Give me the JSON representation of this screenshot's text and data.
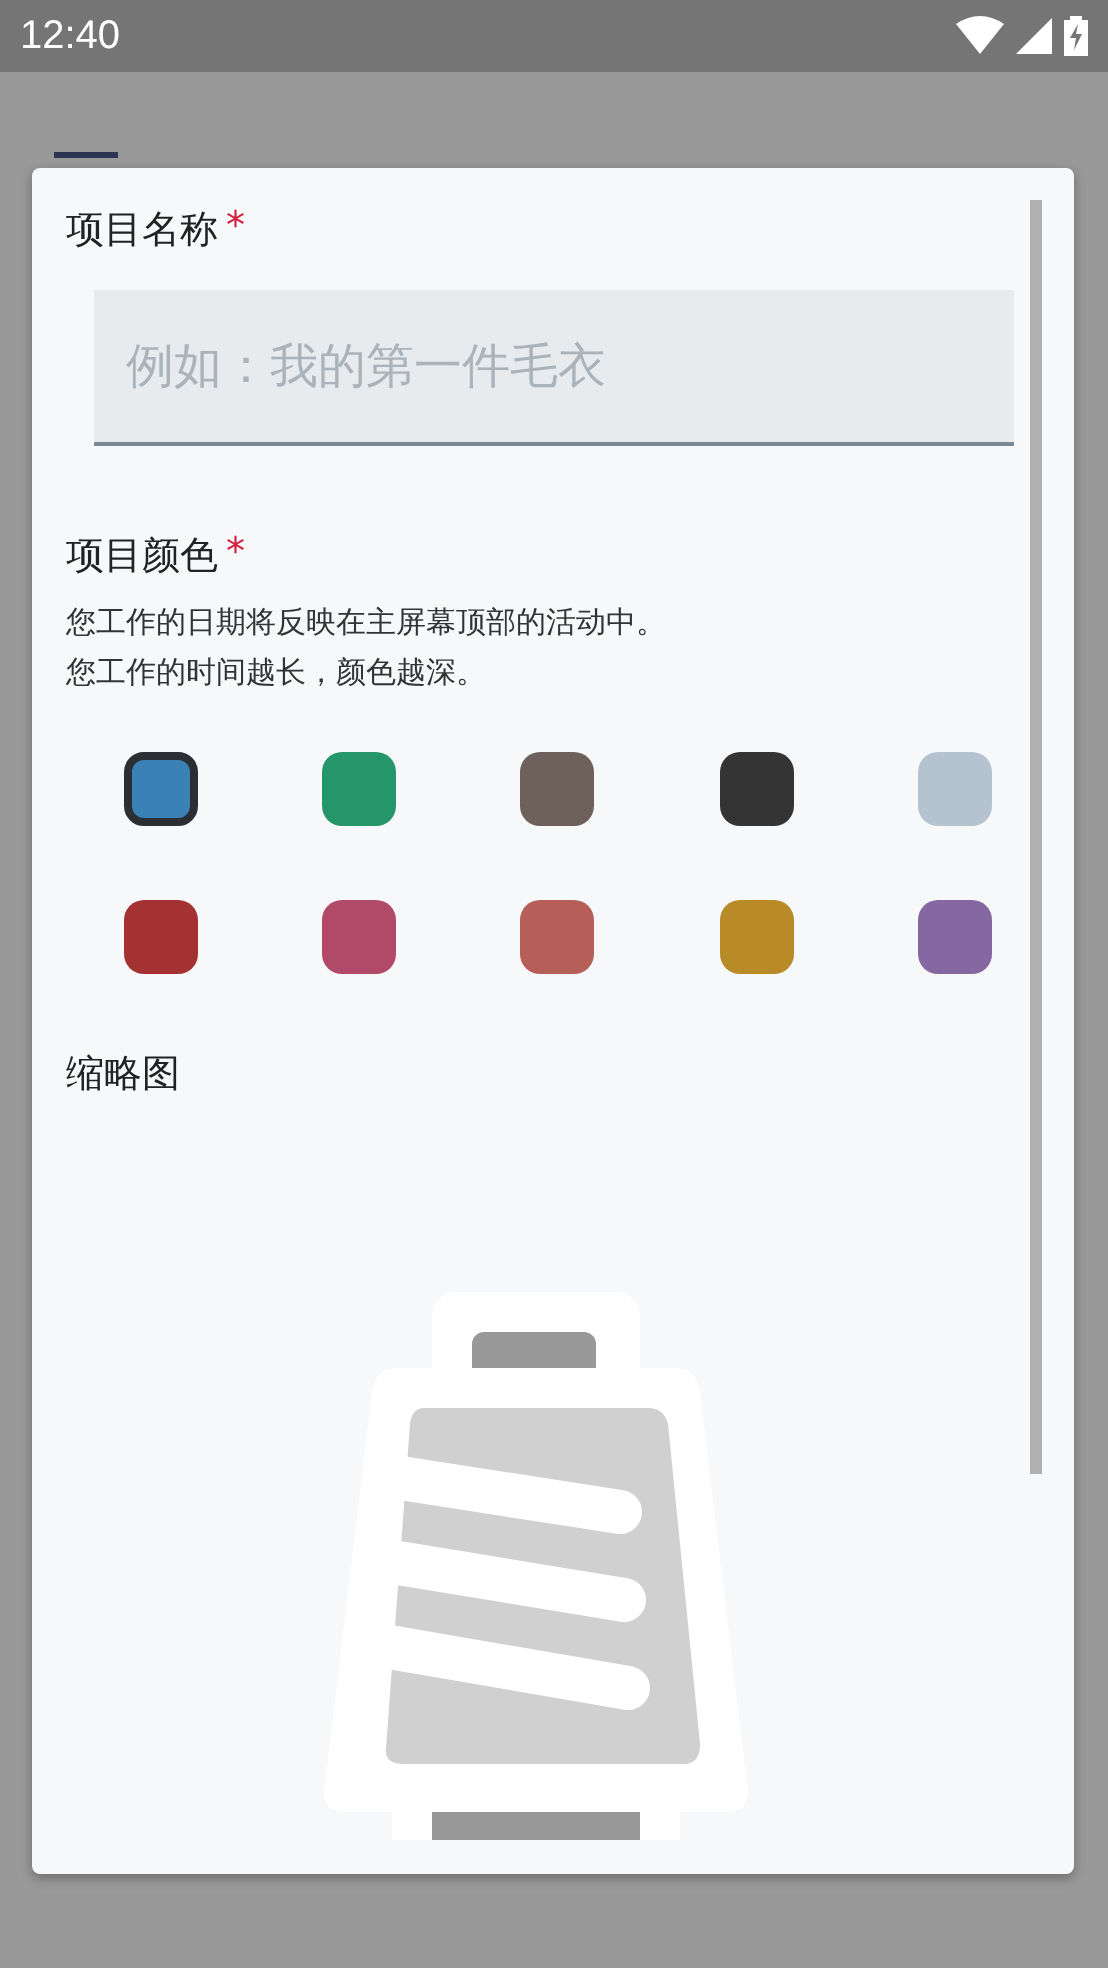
{
  "status_bar": {
    "time": "12:40"
  },
  "dialog": {
    "name_field": {
      "label": "项目名称",
      "required_mark": "*",
      "placeholder": "例如：我的第一件毛衣"
    },
    "color_field": {
      "label": "项目颜色",
      "required_mark": "*",
      "description": [
        "您工作的日期将反映在主屏幕顶部的活动中。",
        "您工作的时间越长，颜色越深。"
      ],
      "colors": [
        {
          "color": "#3a82b5",
          "selected": true
        },
        {
          "color": "#259669",
          "selected": false
        },
        {
          "color": "#6e605b",
          "selected": false
        },
        {
          "color": "#343434",
          "selected": false
        },
        {
          "color": "#b5c3d1",
          "selected": false
        },
        {
          "color": "#a53233",
          "selected": false
        },
        {
          "color": "#b14a68",
          "selected": false
        },
        {
          "color": "#b65f58",
          "selected": false
        },
        {
          "color": "#b88b28",
          "selected": false
        },
        {
          "color": "#8568a1",
          "selected": false
        }
      ]
    },
    "thumbnail": {
      "label": "缩略图"
    }
  }
}
